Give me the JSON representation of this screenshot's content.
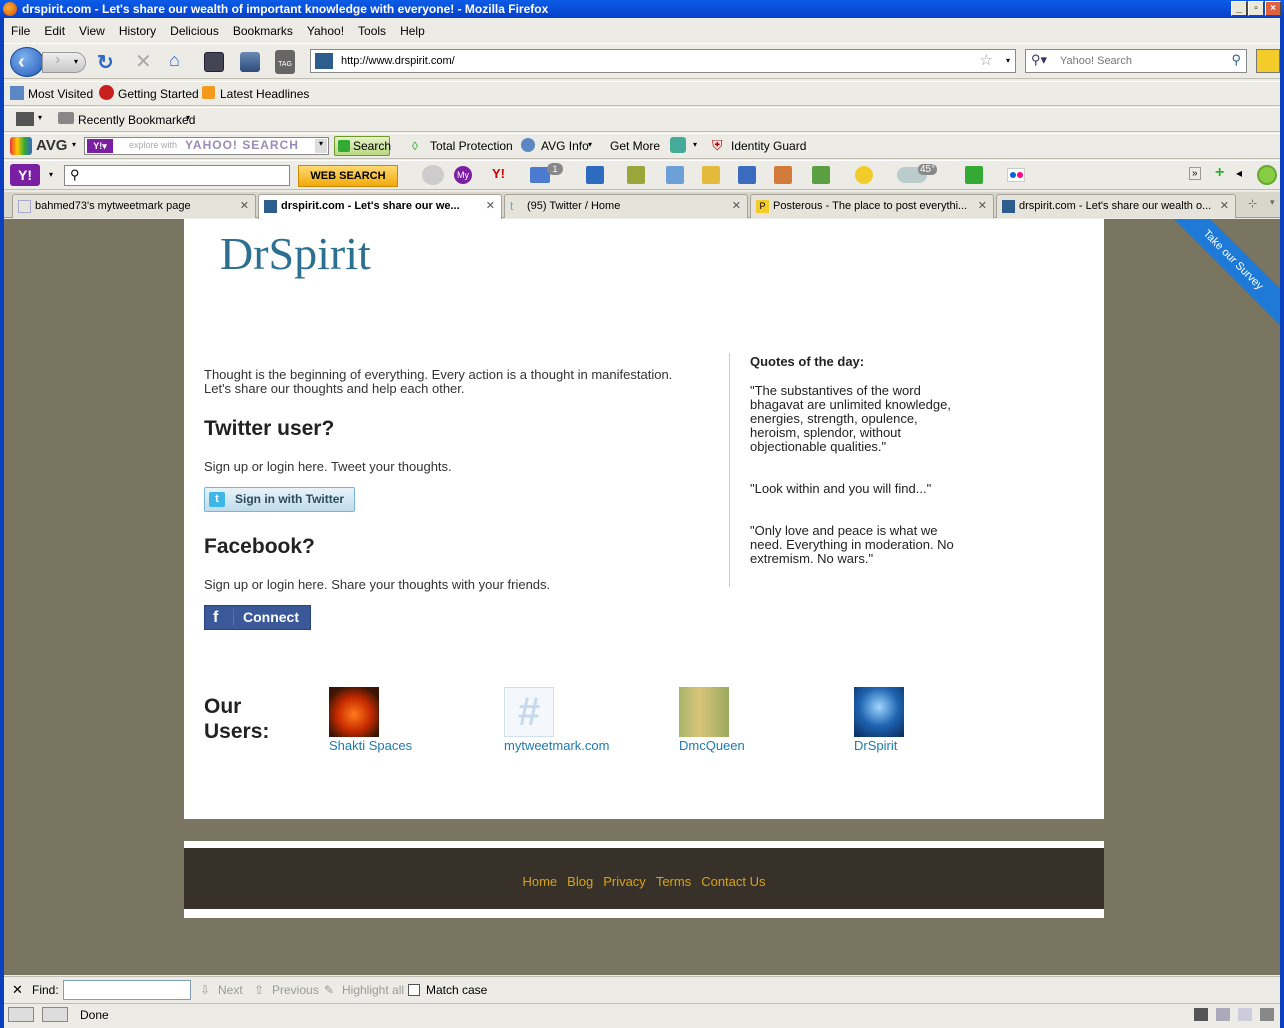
{
  "window": {
    "title": "drspirit.com - Let's share our wealth of important knowledge with everyone! - Mozilla Firefox"
  },
  "menu": [
    "File",
    "Edit",
    "View",
    "History",
    "Delicious",
    "Bookmarks",
    "Yahoo!",
    "Tools",
    "Help"
  ],
  "nav": {
    "url": "http://www.drspirit.com/",
    "search_placeholder": "Yahoo! Search"
  },
  "bookmarks": {
    "most_visited": "Most Visited",
    "getting_started": "Getting Started",
    "latest_headlines": "Latest Headlines",
    "recently_bookmarked": "Recently Bookmarked"
  },
  "avg": {
    "logo": "AVG",
    "search_hint": "explore with",
    "yahoo_search": "YAHOO! SEARCH",
    "search_btn": "Search",
    "total_protection": "Total Protection",
    "avg_info": "AVG Info",
    "get_more": "Get More",
    "identity_guard": "Identity Guard"
  },
  "yahoo_toolbar": {
    "web_search": "WEB SEARCH",
    "mail_badge": "1",
    "weather": "45°"
  },
  "tabs": [
    {
      "label": "bahmed73's mytweetmark page"
    },
    {
      "label": "drspirit.com - Let's share our we..."
    },
    {
      "label": "(95) Twitter / Home"
    },
    {
      "label": "Posterous - The place to post everythi..."
    },
    {
      "label": "drspirit.com - Let's share our wealth o..."
    }
  ],
  "page": {
    "logo": "DrSpirit",
    "survey": "Take our Survey",
    "intro": "Thought is the beginning of everything. Every action is a thought in manifestation. Let's share our thoughts and help each other.",
    "twitter_heading": "Twitter user?",
    "twitter_text": "Sign up or login here. Tweet your thoughts.",
    "twitter_button": "Sign in with Twitter",
    "facebook_heading": "Facebook?",
    "facebook_text": "Sign up or login here. Share your thoughts with your friends.",
    "facebook_button": "Connect",
    "quotes_title": "Quotes of the day:",
    "quotes": [
      "\"The substantives of the word bhagavat are unlimited knowledge, energies, strength, opulence, heroism, splendor, without objectionable qualities.\"",
      "\"Look within and you will find...\"",
      "\"Only love and peace is what we need. Everything in moderation. No extremism. No wars.\""
    ],
    "users_heading_1": "Our",
    "users_heading_2": "Users:",
    "users": [
      "Shakti Spaces",
      "mytweetmark.com",
      "DmcQueen",
      "DrSpirit"
    ],
    "footer_links": [
      "Home",
      "Blog",
      "Privacy",
      "Terms",
      "Contact Us"
    ]
  },
  "findbar": {
    "label": "Find:",
    "next": "Next",
    "previous": "Previous",
    "highlight": "Highlight all",
    "match_case": "Match case"
  },
  "status": "Done"
}
